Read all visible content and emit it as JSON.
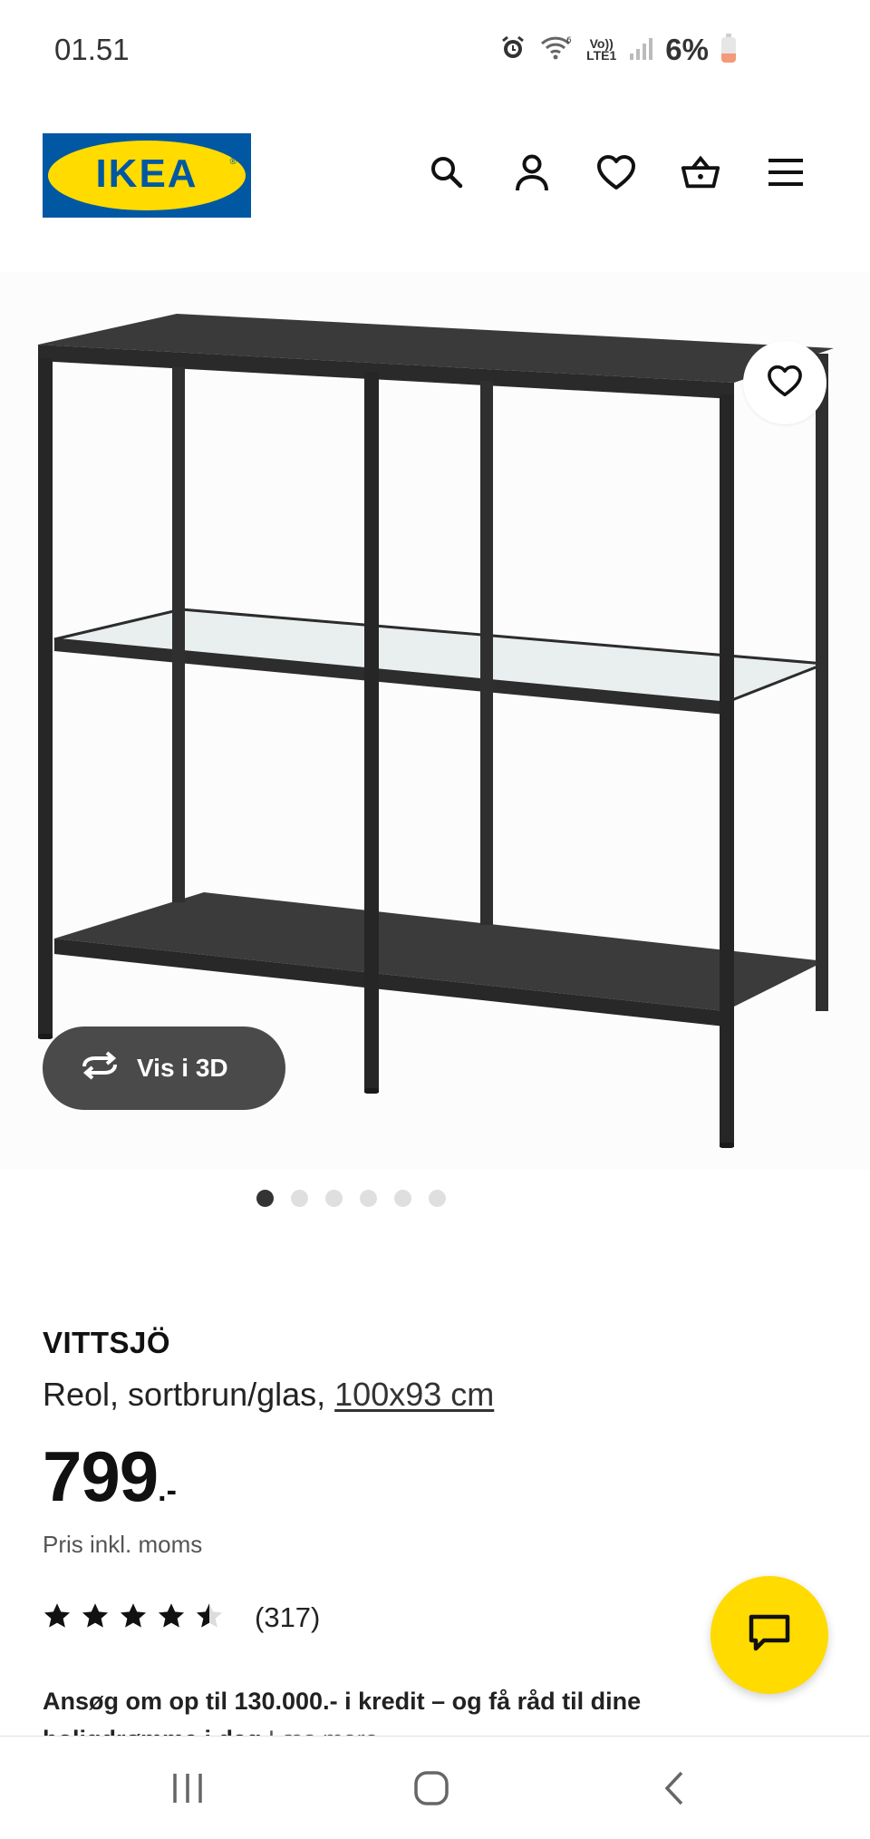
{
  "status_bar": {
    "time": "01.51",
    "signal_network": "LTE1",
    "signal_volte": "Vo))",
    "battery_text": "6%",
    "battery_level": 0.06,
    "icons": [
      "alarm-icon",
      "wifi-icon",
      "volte-icon",
      "signal-icon",
      "battery-icon"
    ]
  },
  "header": {
    "logo_text": "IKEA",
    "icons": [
      "search-icon",
      "account-icon",
      "heart-icon",
      "basket-icon",
      "menu-icon"
    ]
  },
  "gallery": {
    "vis_3d_label": "Vis i 3D",
    "dot_count": 6,
    "active_dot": 0
  },
  "product": {
    "name": "VITTSJÖ",
    "description": "Reol, sortbrun/glas, ",
    "size_link": "100x93 cm",
    "price_main": "799",
    "price_suffix": ".-",
    "vat_text": "Pris inkl. moms",
    "rating": 4.5,
    "rating_max": 5,
    "review_count": "(317)"
  },
  "credit_banner": {
    "text_bold": "Ansøg om op til 130.000.- i kredit – og få råd til dine boligdrømme i dag",
    "link_text": "Læs mere"
  },
  "colors": {
    "ikea_blue": "#0058a3",
    "ikea_yellow": "#ffdb00",
    "battery_low": "#f29a7a"
  }
}
